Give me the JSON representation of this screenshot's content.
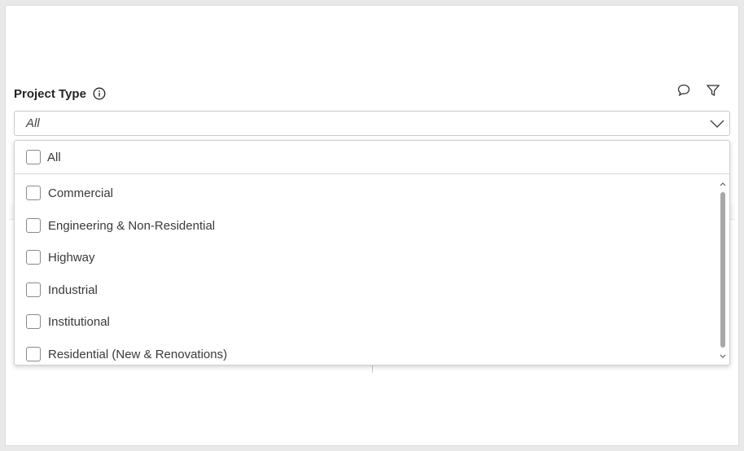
{
  "slicer": {
    "title": "Project Type",
    "selected": "All",
    "select_all_label": "All",
    "items": [
      {
        "label": "Commercial",
        "checked": false
      },
      {
        "label": "Engineering & Non-Residential",
        "checked": false
      },
      {
        "label": "Highway",
        "checked": false
      },
      {
        "label": "Industrial",
        "checked": false
      },
      {
        "label": "Institutional",
        "checked": false
      },
      {
        "label": "Residential (New & Renovations)",
        "checked": false
      }
    ]
  },
  "header_icons": [
    "comment-icon",
    "filter-icon"
  ],
  "colors": {
    "border": "#c8c8c8",
    "text": "#252423",
    "scroll_thumb": "#a8a8a8"
  }
}
